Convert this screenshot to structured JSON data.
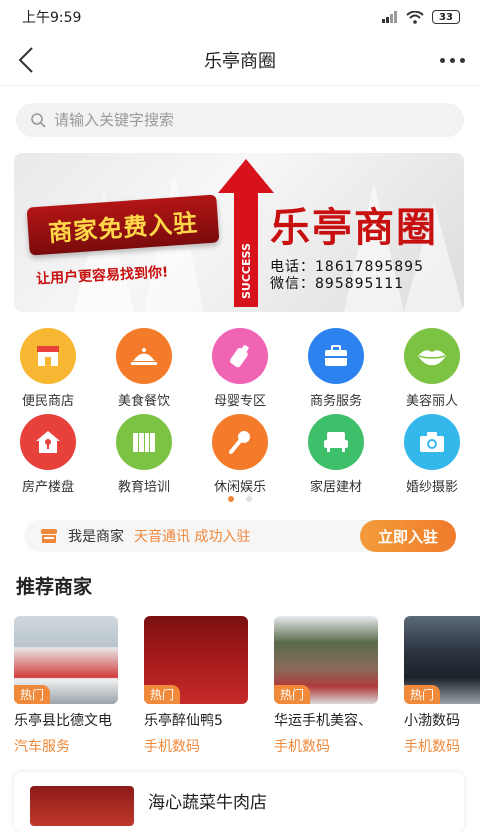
{
  "status_bar": {
    "time": "上午9:59",
    "battery": "33"
  },
  "nav": {
    "title": "乐亭商圈"
  },
  "search": {
    "placeholder": "请输入关键字搜索"
  },
  "banner": {
    "left_text": "商家免费入驻",
    "slogan": "让用户更容易找到你!",
    "arrow_text": "SUCCESS",
    "title": "乐亭商圈",
    "phone": "电话：18617895895",
    "wechat": "微信：895895111"
  },
  "categories": [
    {
      "label": "便民商店",
      "icon": "store-icon",
      "color": "#f7b733"
    },
    {
      "label": "美食餐饮",
      "icon": "dish-cover-icon",
      "color": "#f47b2a"
    },
    {
      "label": "母婴专区",
      "icon": "baby-bottle-icon",
      "color": "#f064b4"
    },
    {
      "label": "商务服务",
      "icon": "briefcase-icon",
      "color": "#2e82f0"
    },
    {
      "label": "美容丽人",
      "icon": "lips-icon",
      "color": "#7cc243"
    },
    {
      "label": "房产楼盘",
      "icon": "house-icon",
      "color": "#e8413c"
    },
    {
      "label": "教育培训",
      "icon": "books-icon",
      "color": "#7cc243"
    },
    {
      "label": "休闲娱乐",
      "icon": "microphone-icon",
      "color": "#f47b2a"
    },
    {
      "label": "家居建材",
      "icon": "sofa-icon",
      "color": "#3ebf6a"
    },
    {
      "label": "婚纱摄影",
      "icon": "camera-icon",
      "color": "#34b7ea"
    }
  ],
  "pager": {
    "pages": 2,
    "active": 1
  },
  "merchant_bar": {
    "label": "我是商家",
    "promo": "天音通讯 成功入驻",
    "button": "立即入驻"
  },
  "recommend": {
    "title": "推荐商家",
    "tag": "热门",
    "stores": [
      {
        "name": "乐亭县比德文电",
        "category": "汽车服务"
      },
      {
        "name": "乐亭醉仙鸭5",
        "category": "手机数码"
      },
      {
        "name": "华运手机美容、",
        "category": "手机数码"
      },
      {
        "name": "小渤数码",
        "category": "手机数码"
      }
    ]
  },
  "list": {
    "first_name": "海心蔬菜牛肉店"
  },
  "colors": {
    "accent": "#f0883a",
    "text": "#222222"
  }
}
